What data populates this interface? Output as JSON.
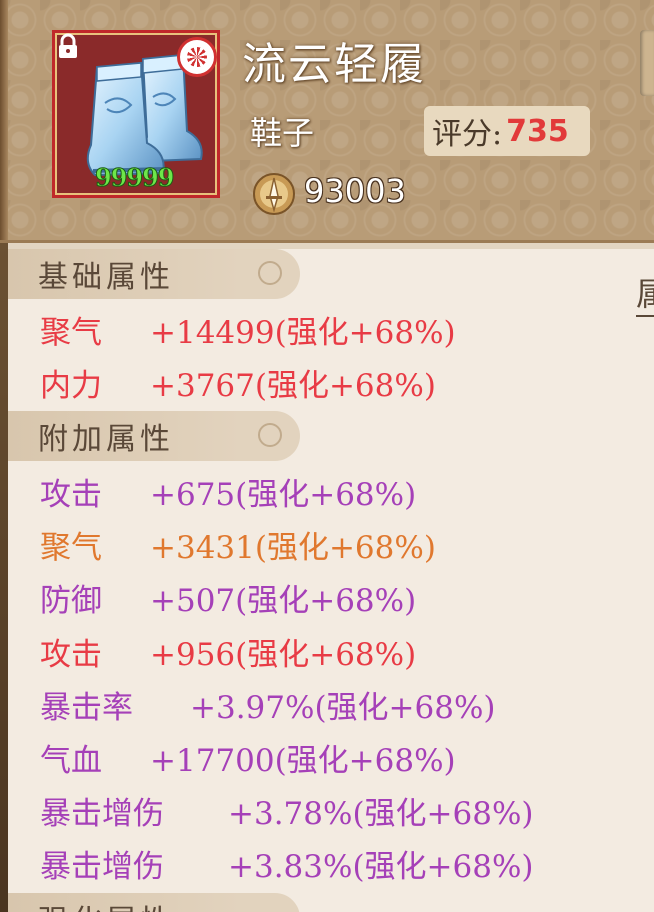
{
  "item": {
    "name": "流云轻履",
    "type": "鞋子",
    "level": "99999",
    "score_label": "评分:",
    "score_value": "735",
    "power": "93003",
    "icon": "boots-icon"
  },
  "right_tab": {
    "label": "属"
  },
  "sections": {
    "basic": {
      "title": "基础属性"
    },
    "extra": {
      "title": "附加属性"
    },
    "enhance": {
      "title": "强化属性"
    }
  },
  "basic_stats": [
    {
      "name": "聚气",
      "value": "+14499(强化+68%)"
    },
    {
      "name": "内力",
      "value": "+3767(强化+68%)"
    }
  ],
  "extra_stats": [
    {
      "name": "攻击",
      "value": "+675(强化+68%)"
    },
    {
      "name": "聚气",
      "value": "+3431(强化+68%)"
    },
    {
      "name": "防御",
      "value": "+507(强化+68%)"
    },
    {
      "name": "攻击",
      "value": "+956(强化+68%)"
    },
    {
      "name": "暴击率",
      "value": "+3.97%(强化+68%)"
    },
    {
      "name": "气血",
      "value": "+17700(强化+68%)"
    },
    {
      "name": "暴击增伤",
      "value": "+3.78%(强化+68%)"
    },
    {
      "name": "暴击增伤",
      "value": "+3.83%(强化+68%)"
    }
  ],
  "colors": {
    "red": "#e83b45",
    "purple": "#a540b8",
    "orange": "#e0782e",
    "score": "#e23a3a"
  }
}
